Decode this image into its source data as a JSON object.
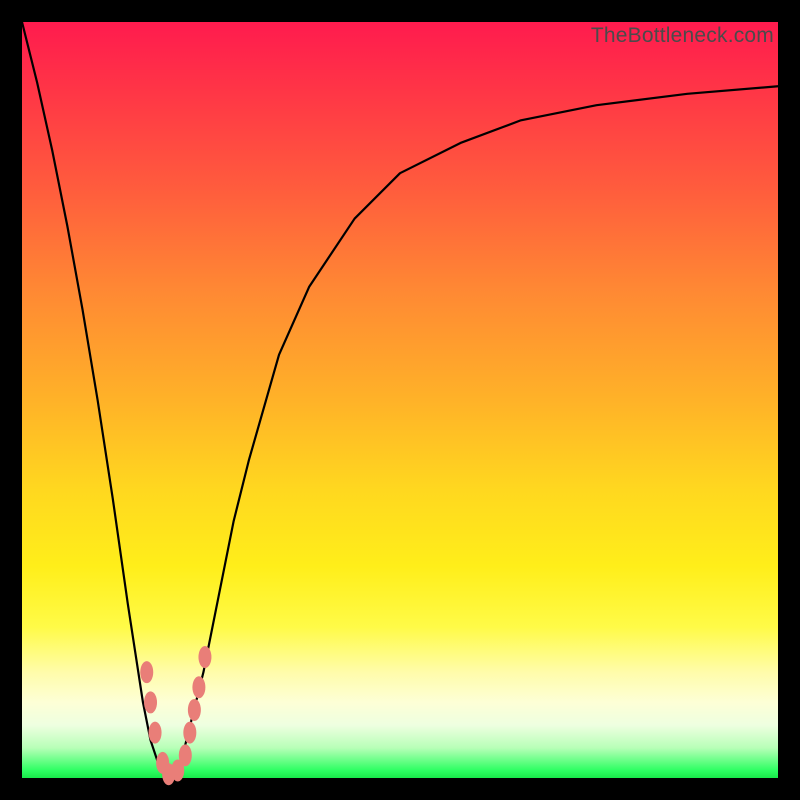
{
  "watermark": "TheBottleneck.com",
  "colors": {
    "frame": "#000000",
    "curve_stroke": "#000000",
    "marker_fill": "#e97e78",
    "marker_stroke": "#c95b57"
  },
  "chart_data": {
    "type": "line",
    "title": "",
    "xlabel": "",
    "ylabel": "",
    "xlim": [
      0,
      100
    ],
    "ylim": [
      0,
      100
    ],
    "x": [
      0,
      2,
      4,
      6,
      8,
      10,
      12,
      14,
      16,
      17,
      18,
      19,
      20,
      21,
      22,
      24,
      26,
      28,
      30,
      34,
      38,
      44,
      50,
      58,
      66,
      76,
      88,
      100
    ],
    "values": [
      100,
      92,
      83,
      73,
      62,
      50,
      37,
      23,
      10,
      5,
      2,
      0,
      0,
      2,
      6,
      14,
      24,
      34,
      42,
      56,
      65,
      74,
      80,
      84,
      87,
      89,
      90.5,
      91.5
    ],
    "markers": [
      {
        "x": 16.5,
        "y": 14
      },
      {
        "x": 17.0,
        "y": 10
      },
      {
        "x": 17.6,
        "y": 6
      },
      {
        "x": 18.6,
        "y": 2
      },
      {
        "x": 19.4,
        "y": 0.5
      },
      {
        "x": 20.6,
        "y": 1.0
      },
      {
        "x": 21.6,
        "y": 3
      },
      {
        "x": 22.2,
        "y": 6
      },
      {
        "x": 22.8,
        "y": 9
      },
      {
        "x": 23.4,
        "y": 12
      },
      {
        "x": 24.2,
        "y": 16
      }
    ]
  }
}
